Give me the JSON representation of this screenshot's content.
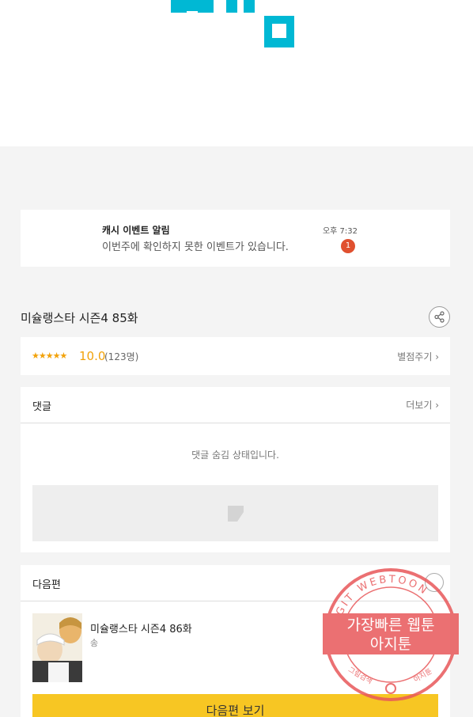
{
  "notice": {
    "title": "캐시 이벤트 알림",
    "message": "이번주에 확인하지 못한 이벤트가 있습니다.",
    "time": "오후 7:32",
    "badge": "1"
  },
  "episode": {
    "title": "미슐랭스타 시즌4 85화"
  },
  "rating": {
    "stars": "★★★★★",
    "score": "10.0",
    "count": "(123명)",
    "rate_button": "별점주기 ›"
  },
  "comments": {
    "title": "댓글",
    "more": "더보기 ›",
    "hidden_message": "댓글 숨김 상태입니다."
  },
  "next": {
    "title": "다음편",
    "episode_title": "미슐랭스타 시즌4 86화",
    "author": "송",
    "button": "다음편 보기"
  },
  "watermark": {
    "ring_text": "AGIT WEBTOON",
    "line1": "가장빠른 웹툰",
    "line2": "아지툰",
    "bottom_left": "그림검색",
    "bottom_right": "아지툰"
  },
  "colors": {
    "accent": "#f7c623",
    "star": "#f2a20a",
    "badge": "#e0502f",
    "brand": "#00b8d4",
    "watermark": "#e8585a"
  }
}
